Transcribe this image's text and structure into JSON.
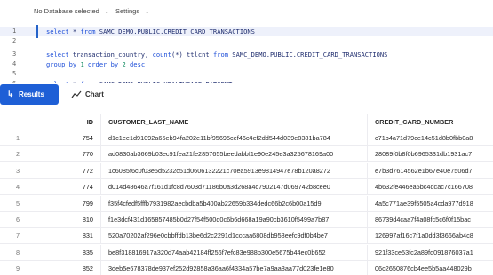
{
  "toolbar": {
    "database_label": "No Database selected",
    "settings_label": "Settings"
  },
  "editor": {
    "lines": [
      {
        "n": "1",
        "parts": [
          {
            "t": "select",
            "c": "kw"
          },
          {
            "t": " * ",
            "c": ""
          },
          {
            "t": "from",
            "c": "kw"
          },
          {
            "t": " SAMC_DEMO.PUBLIC.CREDIT_CARD_TRANSACTIONS",
            "c": ""
          }
        ]
      },
      {
        "n": "2",
        "parts": []
      },
      {
        "n": "3",
        "parts": [
          {
            "t": "select",
            "c": "kw"
          },
          {
            "t": " transaction_country, ",
            "c": ""
          },
          {
            "t": "count",
            "c": "kw"
          },
          {
            "t": "(*) ttlcnt ",
            "c": ""
          },
          {
            "t": "from",
            "c": "kw"
          },
          {
            "t": " SAMC_DEMO.PUBLIC.CREDIT_CARD_TRANSACTIONS",
            "c": ""
          }
        ]
      },
      {
        "n": "4",
        "parts": [
          {
            "t": "group by",
            "c": "kw"
          },
          {
            "t": " ",
            "c": ""
          },
          {
            "t": "1",
            "c": "num"
          },
          {
            "t": " ",
            "c": ""
          },
          {
            "t": "order by",
            "c": "kw"
          },
          {
            "t": " ",
            "c": ""
          },
          {
            "t": "2",
            "c": "num"
          },
          {
            "t": " ",
            "c": ""
          },
          {
            "t": "desc",
            "c": "kw"
          }
        ]
      },
      {
        "n": "5",
        "parts": []
      },
      {
        "n": "6",
        "parts": [
          {
            "t": "select",
            "c": "kw"
          },
          {
            "t": " * ",
            "c": ""
          },
          {
            "t": "from",
            "c": "kw"
          },
          {
            "t": " SAMC_DEMO.PUBLIC.HEALTHCARE_PATIENT",
            "c": ""
          }
        ]
      }
    ]
  },
  "tabs": {
    "results_label": "Results",
    "chart_label": "Chart"
  },
  "table": {
    "columns": [
      "ID",
      "CUSTOMER_LAST_NAME",
      "CREDIT_CARD_NUMBER"
    ],
    "rows": [
      {
        "idx": "1",
        "id": "754",
        "name": "d1c1ee1d91092a65eb94fa202e11bf95695cef46c4ef2dd544d039e8381ba784",
        "card": "c71b4a71d79ce14c51d8b0fbb0a8"
      },
      {
        "idx": "2",
        "id": "770",
        "name": "ad0830ab3669b03ec91fea21fe2857655beedabbf1e90e245e3a325678169a00",
        "card": "28089f0b8f0b6965331db1931ac7"
      },
      {
        "idx": "3",
        "id": "772",
        "name": "1c6085f6c0f03e5d5232c51d0606132221c70ea5913e9814947e78b120a8272",
        "card": "e7b3d7614562e1b67e40e7506d7"
      },
      {
        "idx": "4",
        "id": "774",
        "name": "d014d48646a7f161d1fc8d7603d71186b0a3d268a4c7902147d069742b8cee0",
        "card": "4b632fe446ea5bc4dcac7c166708"
      },
      {
        "idx": "5",
        "id": "799",
        "name": "f35f4cfedf5fffb7931982aecbdba5b400ab22659b334dedc66b2c6b00a15d9",
        "card": "4a5c771ae39f5505a4cda977d918"
      },
      {
        "idx": "6",
        "id": "810",
        "name": "f1e3dcf431d165857485b0d27f54f500d0c6b6d668a19a90cb3610f5499a7b87",
        "card": "86739d4caa7f4a08fc5c6f0f15bac"
      },
      {
        "idx": "7",
        "id": "831",
        "name": "520a70202af296e0cbbffdb13be6d2c2291d1cccaa6808db958eefc9df0b4be7",
        "card": "126997af16c7f1a0dd3f3666ab4c8"
      },
      {
        "idx": "8",
        "id": "835",
        "name": "be8f318816917a320d74aab42184ff256f7efc83e988b300e5675b44ec0b652",
        "card": "921f33ce53fc2a89fd091876037a1"
      },
      {
        "idx": "9",
        "id": "852",
        "name": "3deb5e678378de937ef252d92858a36aa6f4334a57be7a9aa8aa77d023fe1e80",
        "card": "06c2650876cb4ee5b5aa448029b"
      }
    ]
  }
}
